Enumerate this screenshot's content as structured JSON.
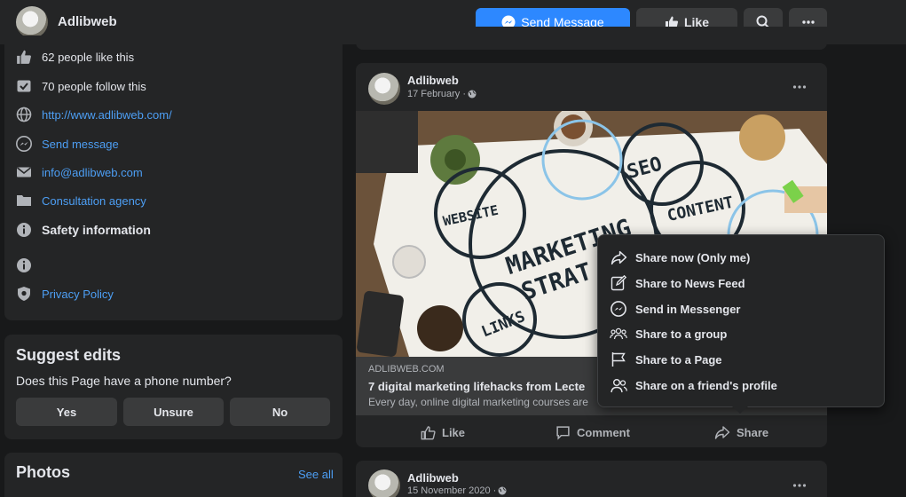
{
  "header": {
    "page_name": "Adlibweb",
    "send_message": "Send Message",
    "like": "Like"
  },
  "about": {
    "likes": "62 people like this",
    "follows": "70 people follow this",
    "website": "http://www.adlibweb.com/",
    "send_message": "Send message",
    "email": "info@adlibweb.com",
    "category": "Consultation agency",
    "safety": "Safety information",
    "privacy": "Privacy Policy"
  },
  "suggest": {
    "title": "Suggest edits",
    "question": "Does this Page have a phone number?",
    "yes": "Yes",
    "unsure": "Unsure",
    "no": "No"
  },
  "photos": {
    "title": "Photos",
    "see_all": "See all"
  },
  "post1": {
    "author": "Adlibweb",
    "date": "17 February · ",
    "image_words": [
      "WEBSITE",
      "SEO",
      "CONTENT",
      "MARKETING",
      "STRAT",
      "LINKS"
    ],
    "link_domain": "ADLIBWEB.COM",
    "link_title": "7 digital marketing lifehacks from Lecte",
    "link_desc": "Every day, online digital marketing courses are",
    "like": "Like",
    "comment": "Comment",
    "share": "Share"
  },
  "post2": {
    "author": "Adlibweb",
    "date": "15 November 2020 · "
  },
  "share_menu": {
    "items": [
      {
        "label": "Share now (Only me)",
        "icon": "share-arrow-icon"
      },
      {
        "label": "Share to News Feed",
        "icon": "edit-icon"
      },
      {
        "label": "Send in Messenger",
        "icon": "messenger-icon"
      },
      {
        "label": "Share to a group",
        "icon": "group-icon"
      },
      {
        "label": "Share to a Page",
        "icon": "flag-icon"
      },
      {
        "label": "Share on a friend's profile",
        "icon": "friend-icon"
      }
    ]
  },
  "colors": {
    "accent": "#2d88ff",
    "link": "#4d9ff5",
    "background": "#18191a",
    "card": "#242526"
  }
}
